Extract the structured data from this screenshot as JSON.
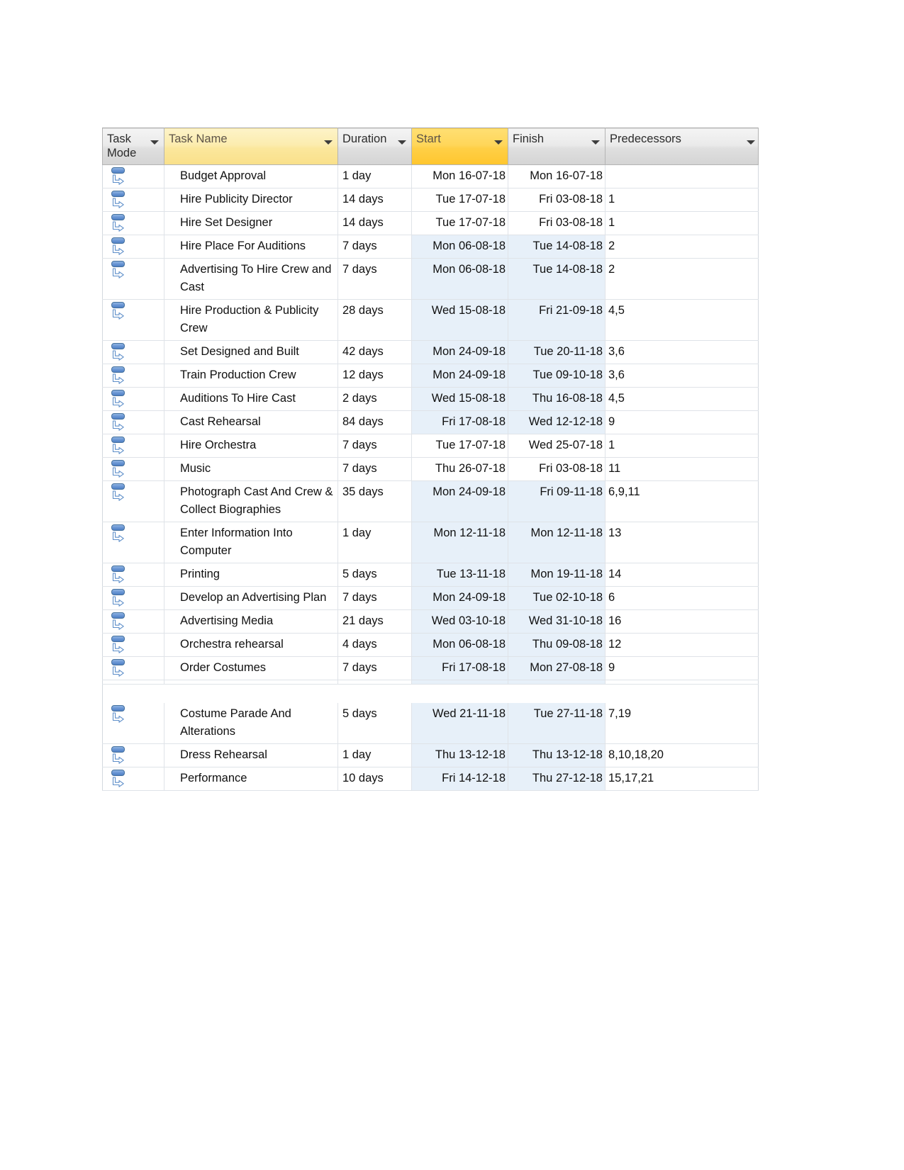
{
  "document": {
    "app": "Microsoft Project",
    "view": "Gantt Chart Entry Table",
    "background_color": "#ffffff"
  },
  "colors": {
    "header_gray": "#e4e4e4",
    "header_yellow_light": "#fbe79c",
    "header_selected_yellow": "#ffcf46",
    "row_tint_blue": "#e7f0f9",
    "grid_line": "#dfe3e8",
    "task_mode_icon": "#4f7fc4",
    "text": "#101010"
  },
  "table": {
    "columns": [
      {
        "id": "task_mode",
        "label": "Task Mode",
        "has_filter_arrow": true,
        "style": "gray",
        "align": "left"
      },
      {
        "id": "task_name",
        "label": "Task Name",
        "has_filter_arrow": true,
        "style": "yellow-light",
        "align": "left"
      },
      {
        "id": "duration",
        "label": "Duration",
        "has_filter_arrow": true,
        "style": "gray",
        "align": "left"
      },
      {
        "id": "start",
        "label": "Start",
        "has_filter_arrow": true,
        "style": "yellow-strong",
        "align": "left"
      },
      {
        "id": "finish",
        "label": "Finish",
        "has_filter_arrow": true,
        "style": "gray",
        "align": "left"
      },
      {
        "id": "predecessors",
        "label": "Predecessors",
        "has_filter_arrow": true,
        "style": "gray",
        "align": "left"
      }
    ],
    "icon_names": {
      "task_mode": "manually-scheduled-icon",
      "filter": "chevron-down-icon"
    },
    "rows": [
      {
        "mode": "manually-scheduled",
        "name": "Budget Approval",
        "duration": "1 day",
        "start": "Mon 16-07-18",
        "finish": "Mon 16-07-18",
        "predecessors": "",
        "tinted": false
      },
      {
        "mode": "manually-scheduled",
        "name": "Hire Publicity Director",
        "duration": "14 days",
        "start": "Tue 17-07-18",
        "finish": "Fri 03-08-18",
        "predecessors": "1",
        "tinted": false
      },
      {
        "mode": "manually-scheduled",
        "name": "Hire Set Designer",
        "duration": "14 days",
        "start": "Tue 17-07-18",
        "finish": "Fri 03-08-18",
        "predecessors": "1",
        "tinted": false
      },
      {
        "mode": "manually-scheduled",
        "name": "Hire Place For Auditions",
        "duration": "7 days",
        "start": "Mon 06-08-18",
        "finish": "Tue 14-08-18",
        "predecessors": "2",
        "tinted": true
      },
      {
        "mode": "manually-scheduled",
        "name": "Advertising To Hire Crew and Cast",
        "duration": "7 days",
        "start": "Mon 06-08-18",
        "finish": "Tue 14-08-18",
        "predecessors": "2",
        "tinted": true
      },
      {
        "mode": "manually-scheduled",
        "name": "Hire Production & Publicity Crew",
        "duration": "28 days",
        "start": "Wed 15-08-18",
        "finish": "Fri 21-09-18",
        "predecessors": "4,5",
        "tinted": true
      },
      {
        "mode": "manually-scheduled",
        "name": "Set Designed and Built",
        "duration": "42 days",
        "start": "Mon 24-09-18",
        "finish": "Tue 20-11-18",
        "predecessors": "3,6",
        "tinted": true
      },
      {
        "mode": "manually-scheduled",
        "name": "Train Production Crew",
        "duration": "12 days",
        "start": "Mon 24-09-18",
        "finish": "Tue 09-10-18",
        "predecessors": "3,6",
        "tinted": true
      },
      {
        "mode": "manually-scheduled",
        "name": "Auditions To Hire Cast",
        "duration": "2 days",
        "start": "Wed 15-08-18",
        "finish": "Thu 16-08-18",
        "predecessors": "4,5",
        "tinted": true
      },
      {
        "mode": "manually-scheduled",
        "name": "Cast Rehearsal",
        "duration": "84 days",
        "start": "Fri 17-08-18",
        "finish": "Wed 12-12-18",
        "predecessors": "9",
        "tinted": true
      },
      {
        "mode": "manually-scheduled",
        "name": "Hire Orchestra",
        "duration": "7 days",
        "start": "Tue 17-07-18",
        "finish": "Wed 25-07-18",
        "predecessors": "1",
        "tinted": false
      },
      {
        "mode": "manually-scheduled",
        "name": "Music",
        "duration": "7 days",
        "start": "Thu 26-07-18",
        "finish": "Fri 03-08-18",
        "predecessors": "11",
        "tinted": false
      },
      {
        "mode": "manually-scheduled",
        "name": "Photograph Cast And Crew & Collect Biographies",
        "duration": "35 days",
        "start": "Mon 24-09-18",
        "finish": "Fri 09-11-18",
        "predecessors": "6,9,11",
        "tinted": true
      },
      {
        "mode": "manually-scheduled",
        "name": "Enter Information Into Computer",
        "duration": "1 day",
        "start": "Mon 12-11-18",
        "finish": "Mon 12-11-18",
        "predecessors": "13",
        "tinted": true
      },
      {
        "mode": "manually-scheduled",
        "name": "Printing",
        "duration": "5 days",
        "start": "Tue 13-11-18",
        "finish": "Mon 19-11-18",
        "predecessors": "14",
        "tinted": true
      },
      {
        "mode": "manually-scheduled",
        "name": "Develop an Advertising Plan",
        "duration": "7 days",
        "start": "Mon 24-09-18",
        "finish": "Tue 02-10-18",
        "predecessors": "6",
        "tinted": true
      },
      {
        "mode": "manually-scheduled",
        "name": "Advertising Media",
        "duration": "21 days",
        "start": "Wed 03-10-18",
        "finish": "Wed 31-10-18",
        "predecessors": "16",
        "tinted": true
      },
      {
        "mode": "manually-scheduled",
        "name": "Orchestra rehearsal",
        "duration": "4 days",
        "start": "Mon 06-08-18",
        "finish": "Thu 09-08-18",
        "predecessors": "12",
        "tinted": true
      },
      {
        "mode": "manually-scheduled",
        "name": "Order Costumes",
        "duration": "7 days",
        "start": "Fri 17-08-18",
        "finish": "Mon 27-08-18",
        "predecessors": "9",
        "tinted": true
      },
      {
        "mode": "manually-scheduled",
        "name": "Costume Parade And Alterations",
        "duration": "5 days",
        "start": "Wed 21-11-18",
        "finish": "Tue 27-11-18",
        "predecessors": "7,19",
        "tinted": true
      },
      {
        "mode": "manually-scheduled",
        "name": "Dress Rehearsal",
        "duration": "1 day",
        "start": "Thu 13-12-18",
        "finish": "Thu 13-12-18",
        "predecessors": "8,10,18,20",
        "tinted": true
      },
      {
        "mode": "manually-scheduled",
        "name": "Performance",
        "duration": "10 days",
        "start": "Fri 14-12-18",
        "finish": "Thu 27-12-18",
        "predecessors": "15,17,21",
        "tinted": true
      }
    ],
    "page_break_after_row_index": 18
  }
}
